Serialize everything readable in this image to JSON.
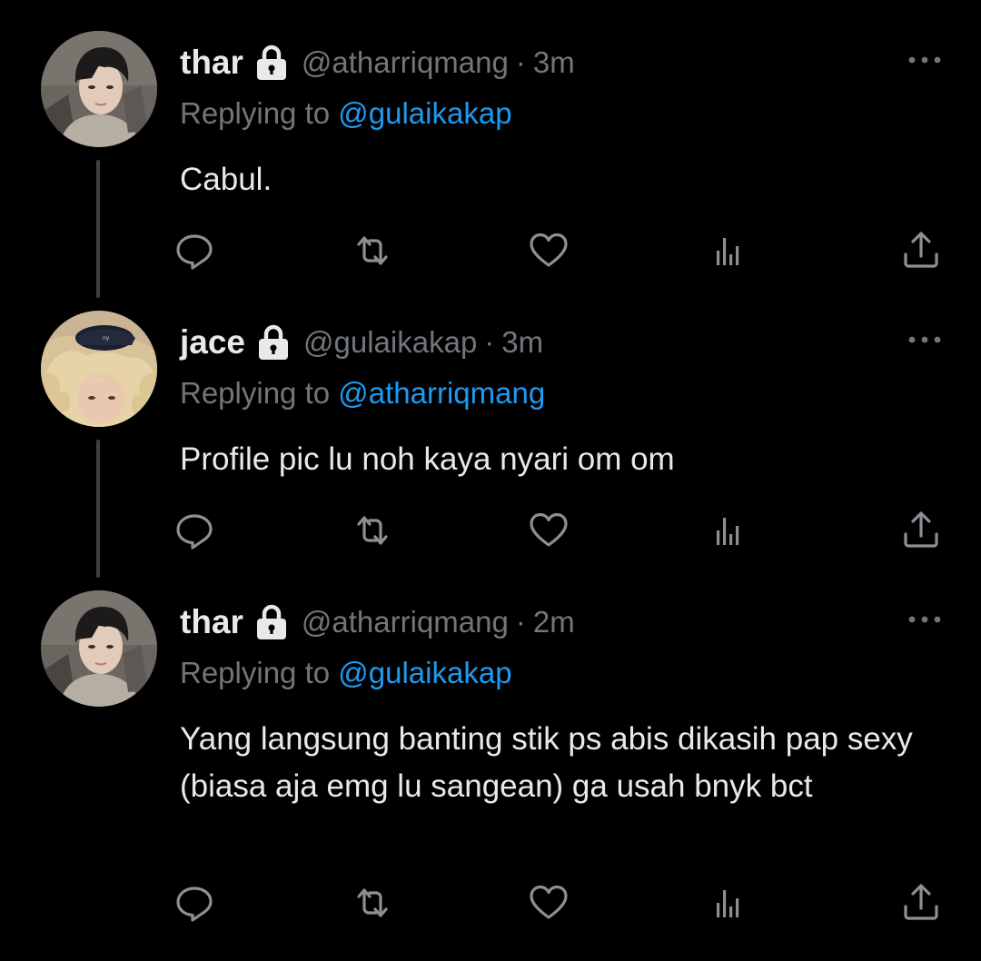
{
  "tweets": [
    {
      "name": "thar",
      "handle": "@atharriqmang",
      "separator": "·",
      "time": "3m",
      "replying_prefix": "Replying to ",
      "replying_to": "@gulaikakap",
      "text": "Cabul."
    },
    {
      "name": "jace",
      "handle": "@gulaikakap",
      "separator": "·",
      "time": "3m",
      "replying_prefix": "Replying to ",
      "replying_to": "@atharriqmang",
      "text": "Profile pic lu noh kaya nyari om om"
    },
    {
      "name": "thar",
      "handle": "@atharriqmang",
      "separator": "·",
      "time": "2m",
      "replying_prefix": "Replying to ",
      "replying_to": "@gulaikakap",
      "text": "Yang langsung banting stik ps abis dikasih pap sexy (biasa aja emg lu sangean) ga usah bnyk bct"
    }
  ],
  "icons": {
    "lock": "lock-icon",
    "more": "more-options-icon",
    "reply": "reply-icon",
    "retweet": "retweet-icon",
    "like": "like-icon",
    "views": "views-icon",
    "share": "share-icon"
  },
  "colors": {
    "background": "#000000",
    "text": "#e7e9ea",
    "secondary": "#71767b",
    "mention": "#1d9bf0",
    "thread_line": "#3e4144"
  }
}
